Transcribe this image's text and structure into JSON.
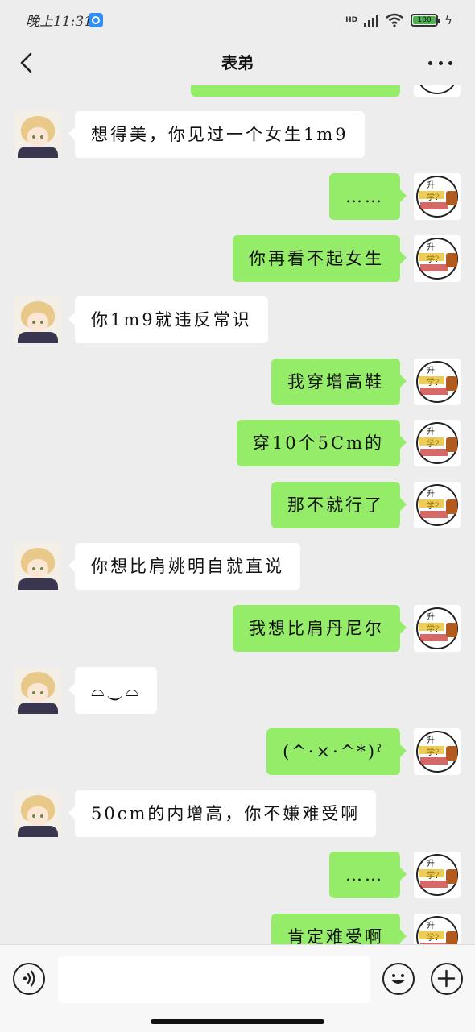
{
  "status_bar": {
    "time": "晚上11:31",
    "network": "HD",
    "battery": "100"
  },
  "header": {
    "title": "表弟"
  },
  "messages": [
    {
      "side": "left",
      "text": "想得美，你见过一个女生1m9"
    },
    {
      "side": "right",
      "text": "……"
    },
    {
      "side": "right",
      "text": "你再看不起女生"
    },
    {
      "side": "left",
      "text": "你1m9就违反常识"
    },
    {
      "side": "right",
      "text": "我穿增高鞋"
    },
    {
      "side": "right",
      "text": "穿10个5Cm的"
    },
    {
      "side": "right",
      "text": "那不就行了"
    },
    {
      "side": "left",
      "text": "你想比肩姚明自就直说"
    },
    {
      "side": "right",
      "text": "我想比肩丹尼尔"
    },
    {
      "side": "left",
      "text": "⌓‿⌓"
    },
    {
      "side": "right",
      "text": "(^·×·^*)ˀ"
    },
    {
      "side": "left",
      "text": "50cm的内增高，你不嫌难受啊"
    },
    {
      "side": "right",
      "text": "……"
    },
    {
      "side": "right",
      "text": "肯定难受啊"
    }
  ],
  "input": {
    "value": "",
    "placeholder": ""
  },
  "icons": {
    "back": "chevron-left-icon",
    "more": "more-horizontal-icon",
    "voice": "voice-icon",
    "emoji": "emoji-icon",
    "plus": "plus-icon"
  },
  "colors": {
    "background": "#ededed",
    "sent_bubble": "#95ec69",
    "received_bubble": "#ffffff"
  }
}
